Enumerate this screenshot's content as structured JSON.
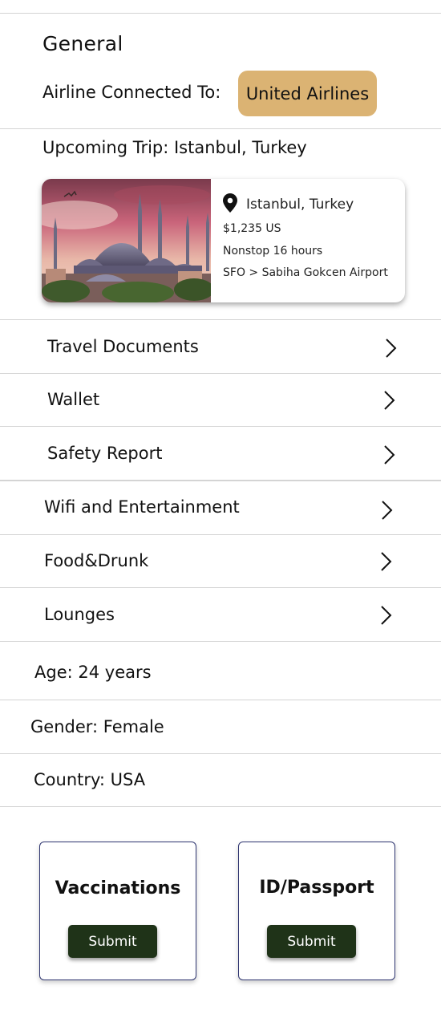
{
  "general": {
    "title": "General",
    "airline_label": "Airline Connected To:",
    "airline_value": "United Airlines",
    "upcoming_trip": "Upcoming Trip: Istanbul, Turkey"
  },
  "trip": {
    "city": "Istanbul, Turkey",
    "price": "$1,235 US",
    "duration": "Nonstop 16 hours",
    "route": "SFO > Sabiha Gokcen Airport",
    "icon": "location-pin-icon"
  },
  "menu": [
    {
      "label": "Travel Documents",
      "icon": "chevron-right-icon"
    },
    {
      "label": "Wallet",
      "icon": "chevron-right-icon"
    },
    {
      "label": "Safety Report",
      "icon": "chevron-right-icon"
    },
    {
      "label": "Wifi and Entertainment",
      "icon": "chevron-right-icon"
    },
    {
      "label": "Food&Drunk",
      "icon": "chevron-right-icon"
    },
    {
      "label": "Lounges",
      "icon": "chevron-right-icon"
    }
  ],
  "profile": {
    "age": "Age: 24 years",
    "gender": "Gender: Female",
    "country": "Country: USA"
  },
  "uploads": [
    {
      "title": "Vaccinations",
      "button": "Submit"
    },
    {
      "title": "ID/Passport",
      "button": "Submit"
    }
  ],
  "colors": {
    "accent": "#dbb373",
    "button": "#1f3318",
    "card_border": "#2e3570"
  }
}
